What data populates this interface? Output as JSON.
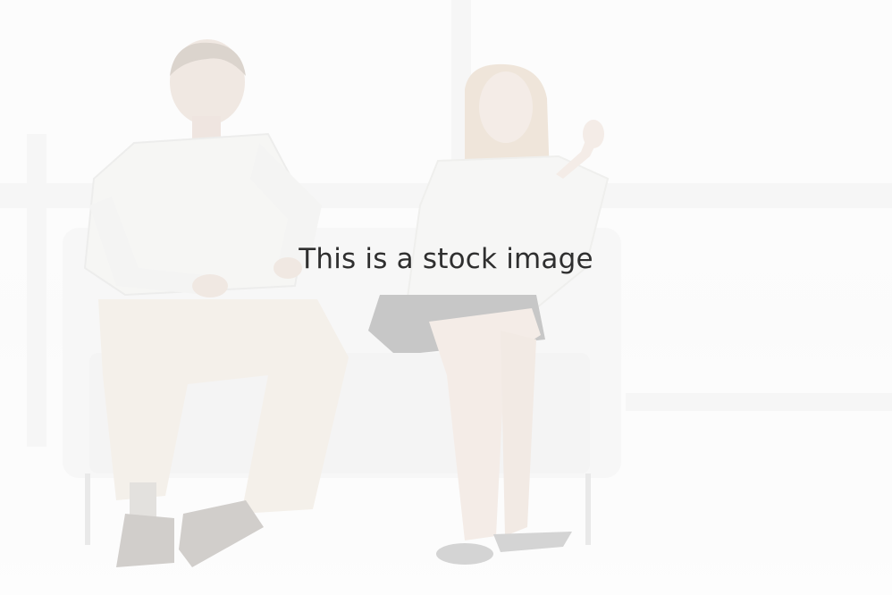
{
  "overlay": {
    "caption": "This is a stock image"
  },
  "photo": {
    "subjects": [
      "man-seated",
      "woman-seated"
    ],
    "colors": {
      "wash": "#f8f8f8",
      "sofa": "#f2f2f2",
      "skin": "#e9dcd3",
      "hair_man": "#c8bdb3",
      "hair_woman": "#e6d8c6",
      "shirt": "#f1f1ef",
      "pants": "#efe9df",
      "shoes": "#b9b4b0",
      "skirt": "#a9a9a9",
      "window_frame": "#eeeeee",
      "caption_text": "#2f2f2f"
    }
  }
}
